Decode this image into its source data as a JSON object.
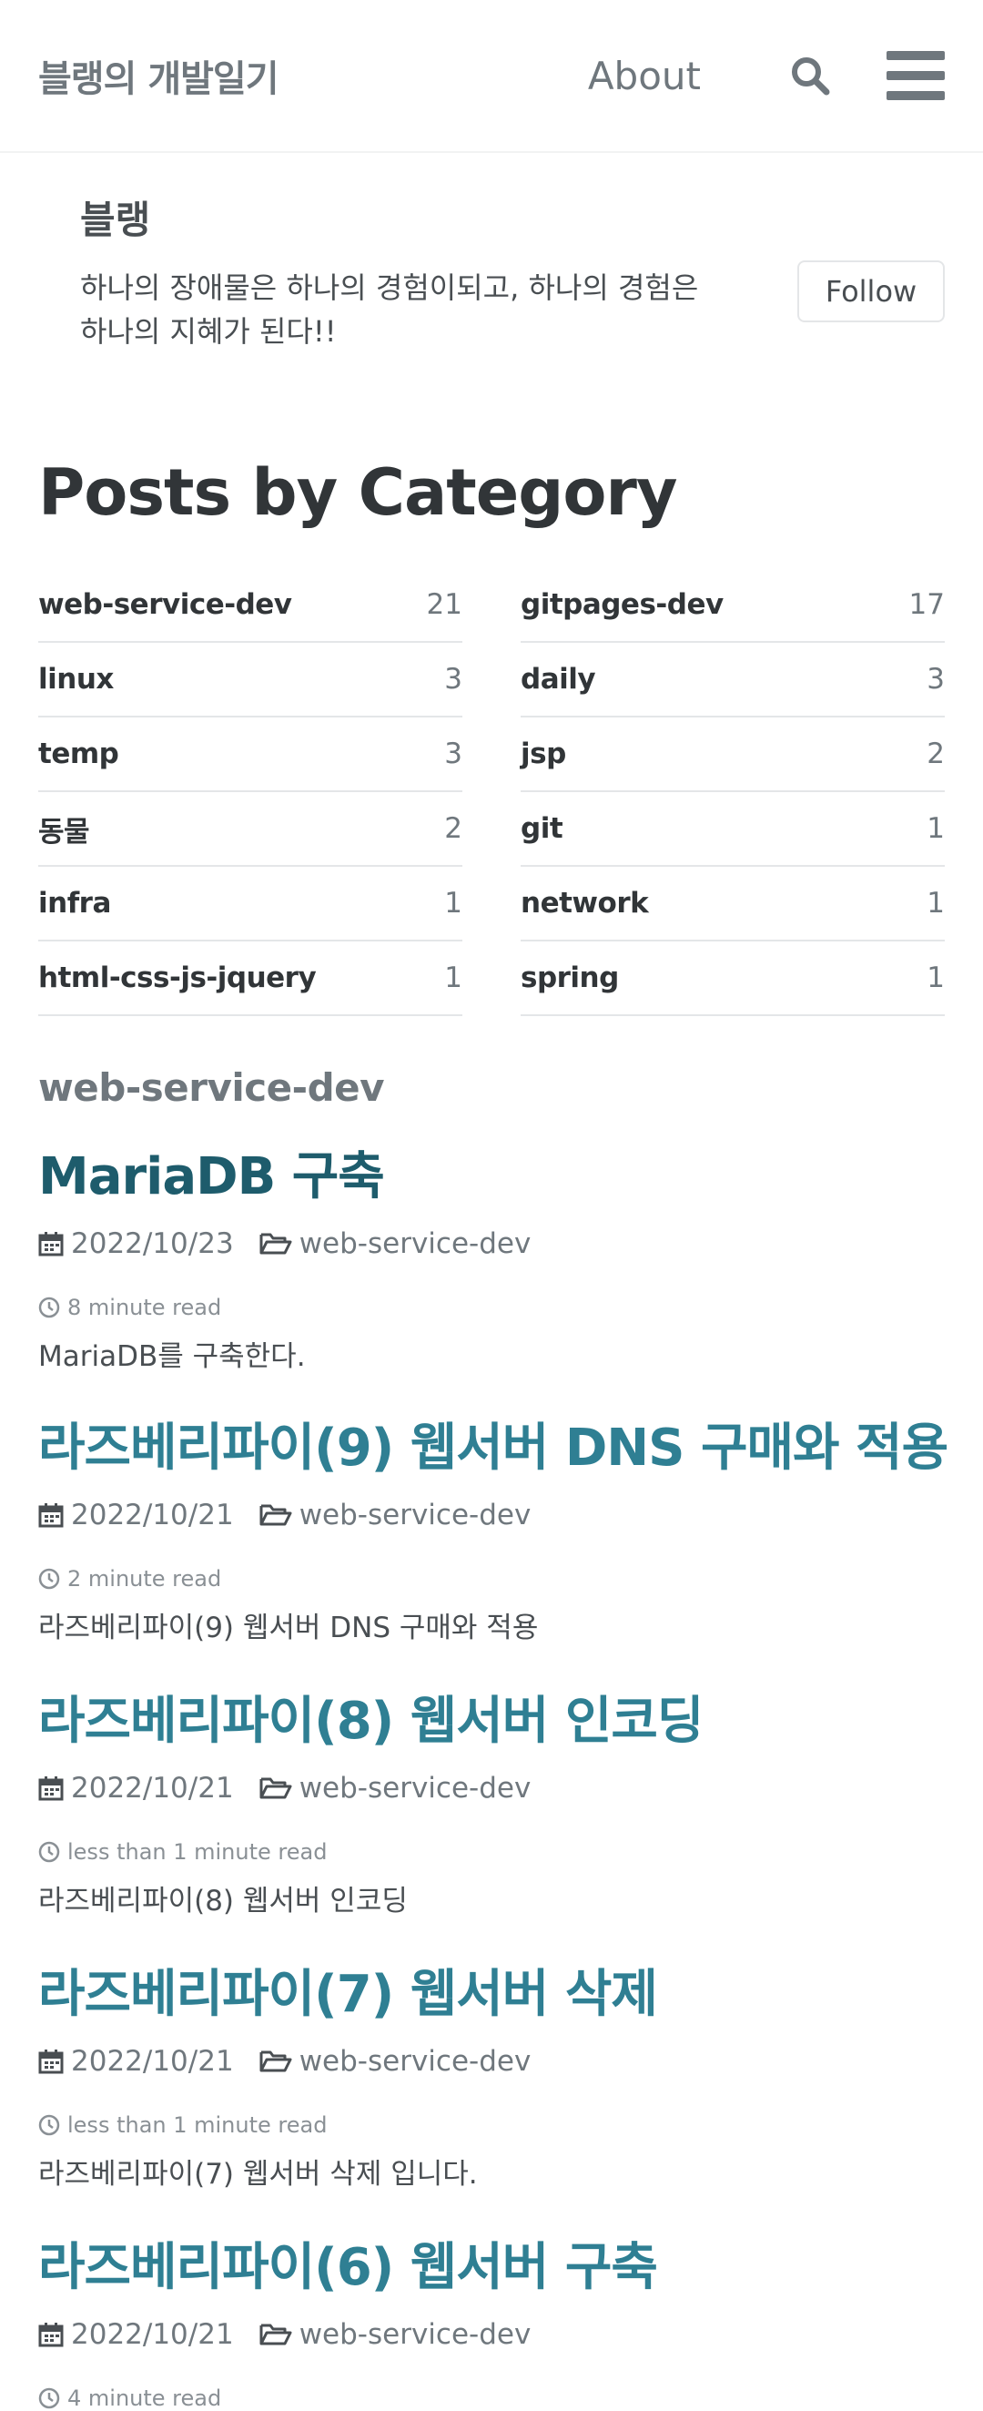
{
  "header": {
    "site_title": "블랭의 개발일기",
    "nav_about": "About",
    "search_icon": "search-icon",
    "menu_icon": "hamburger-menu-icon"
  },
  "author": {
    "name": "블랭",
    "bio": "하나의 장애물은 하나의 경험이되고, 하나의 경험은 하나의 지혜가 된다!!",
    "follow_label": "Follow"
  },
  "page_title": "Posts by Category",
  "categories": [
    {
      "name": "web-service-dev",
      "count": "21"
    },
    {
      "name": "gitpages-dev",
      "count": "17"
    },
    {
      "name": "linux",
      "count": "3"
    },
    {
      "name": "daily",
      "count": "3"
    },
    {
      "name": "temp",
      "count": "3"
    },
    {
      "name": "jsp",
      "count": "2"
    },
    {
      "name": "동물",
      "count": "2"
    },
    {
      "name": "git",
      "count": "1"
    },
    {
      "name": "infra",
      "count": "1"
    },
    {
      "name": "network",
      "count": "1"
    },
    {
      "name": "html-css-js-jquery",
      "count": "1"
    },
    {
      "name": "spring",
      "count": "1"
    }
  ],
  "section_title": "web-service-dev",
  "posts": [
    {
      "title": "MariaDB 구축",
      "date": "2022/10/23",
      "category": "web-service-dev",
      "read_time": "8 minute read",
      "excerpt": "MariaDB를 구축한다."
    },
    {
      "title": "라즈베리파이(9) 웹서버 DNS 구매와 적용",
      "date": "2022/10/21",
      "category": "web-service-dev",
      "read_time": "2 minute read",
      "excerpt": "라즈베리파이(9) 웹서버 DNS 구매와 적용"
    },
    {
      "title": "라즈베리파이(8) 웹서버 인코딩",
      "date": "2022/10/21",
      "category": "web-service-dev",
      "read_time": "less than 1 minute read",
      "excerpt": "라즈베리파이(8) 웹서버 인코딩"
    },
    {
      "title": "라즈베리파이(7) 웹서버 삭제",
      "date": "2022/10/21",
      "category": "web-service-dev",
      "read_time": "less than 1 minute read",
      "excerpt": "라즈베리파이(7) 웹서버 삭제 입니다."
    },
    {
      "title": "라즈베리파이(6) 웹서버 구축",
      "date": "2022/10/21",
      "category": "web-service-dev",
      "read_time": "4 minute read",
      "excerpt": ""
    }
  ],
  "colors": {
    "link": "#2f7f93",
    "visited_link": "#1e5c6c",
    "muted": "#6f777d",
    "text": "#494e52"
  }
}
